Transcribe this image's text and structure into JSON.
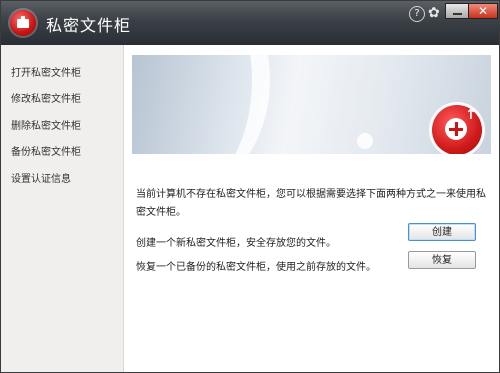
{
  "window": {
    "title": "私密文件柜",
    "help_label": "?",
    "gear_label": "✿",
    "close_label": "✕"
  },
  "sidebar": {
    "items": [
      {
        "label": "打开私密文件柜"
      },
      {
        "label": "修改私密文件柜"
      },
      {
        "label": "删除私密文件柜"
      },
      {
        "label": "备份私密文件柜"
      },
      {
        "label": "设置认证信息"
      }
    ]
  },
  "main": {
    "intro": "当前计算机不存在私密文件柜，您可以根据需要选择下面两种方式之一来使用私密文件柜。",
    "create_text": "创建一个新私密文件柜，安全存放您的文件。",
    "create_button": "创建",
    "restore_text": "恢复一个已备份的私密文件柜，使用之前存放的文件。",
    "restore_button": "恢复"
  },
  "colors": {
    "titlebar": "#3b4047",
    "accent_red": "#d01a1a",
    "sidebar_bg": "#f0efee"
  }
}
